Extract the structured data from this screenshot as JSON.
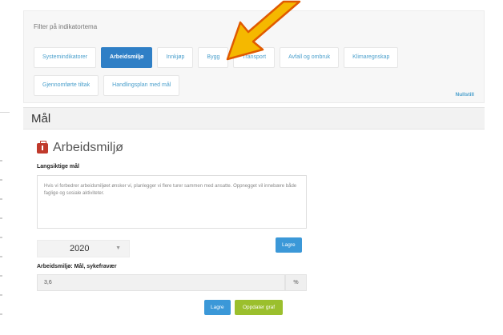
{
  "filter": {
    "title": "Filter på indikatortema",
    "row1": [
      "Systemindikatorer",
      "Arbeidsmiljø",
      "Innkjøp",
      "Bygg",
      "Transport",
      "Avfall og ombruk",
      "Klimaregnskap"
    ],
    "row2": [
      "Gjennomførte tiltak",
      "Handlingsplan med mål"
    ],
    "active": "Arbeidsmiljø",
    "reset_label": "Nullstill"
  },
  "section": {
    "bar_title": "Mål",
    "heading": "Arbeidsmiljø",
    "longterm_label": "Langsiktige mål",
    "longterm_text": "Hvis vi forbedrer arbeidsmiljøet ønsker vi, planlegger vi flere turer sammen med ansatte. Oppnegget vil innebære både faglige og sosiale aktiviteter.",
    "year": "2020",
    "save_label": "Lagre",
    "metric_label": "Arbeidsmiljø: Mål, sykefravær",
    "metric_value": "3,6",
    "unit": "%",
    "save_label_2": "Lagre",
    "update_chart_label": "Oppdater graf"
  },
  "icons": {
    "section_icon": "briefcase-icon",
    "annotation": "arrow-pointer",
    "arrow_color": "#f5b800"
  }
}
